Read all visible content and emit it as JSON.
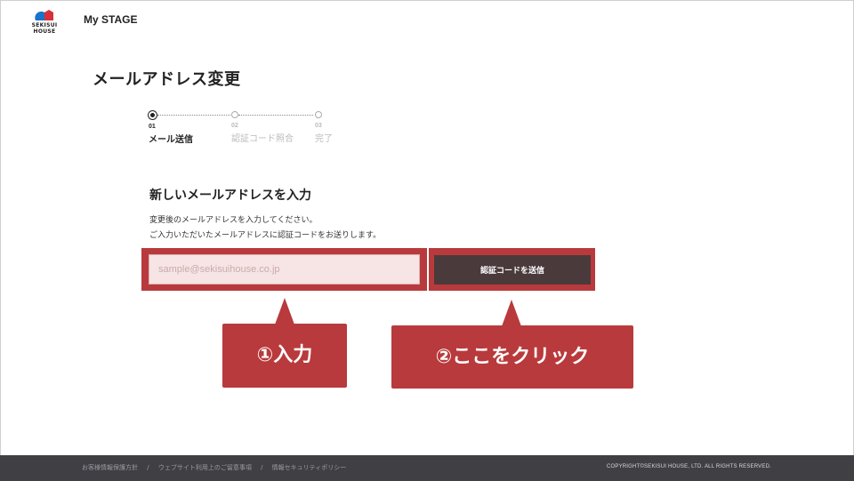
{
  "header": {
    "logo_text": "SEKISUI HOUSE",
    "app_title": "My STAGE"
  },
  "page": {
    "title": "メールアドレス変更"
  },
  "steps": [
    {
      "num": "01",
      "label": "メール送信",
      "active": true
    },
    {
      "num": "02",
      "label": "認証コード照合",
      "active": false
    },
    {
      "num": "03",
      "label": "完了",
      "active": false
    }
  ],
  "form": {
    "section_title": "新しいメールアドレスを入力",
    "desc_line1": "変更後のメールアドレスを入力してください。",
    "desc_line2": "ご入力いただいたメールアドレスに認証コードをお送りします。",
    "email_placeholder": "sample@sekisuihouse.co.jp",
    "email_value": "",
    "submit_label": "認証コードを送信"
  },
  "callouts": {
    "input_label": "①入力",
    "click_label": "②ここをクリック"
  },
  "footer": {
    "links": [
      "お客様情報保護方針",
      "ウェブサイト利用上のご留意事項",
      "情報セキュリティポリシー"
    ],
    "separator": "/",
    "copyright": "COPYRIGHT©SEKISUI HOUSE, LTD. ALL RIGHTS RESERVED."
  },
  "colors": {
    "highlight": "#b93a3c",
    "button": "#4a3a3c",
    "footer_bg": "#3f3f44",
    "logo_blue": "#1a73c8",
    "logo_red": "#d6303a"
  }
}
